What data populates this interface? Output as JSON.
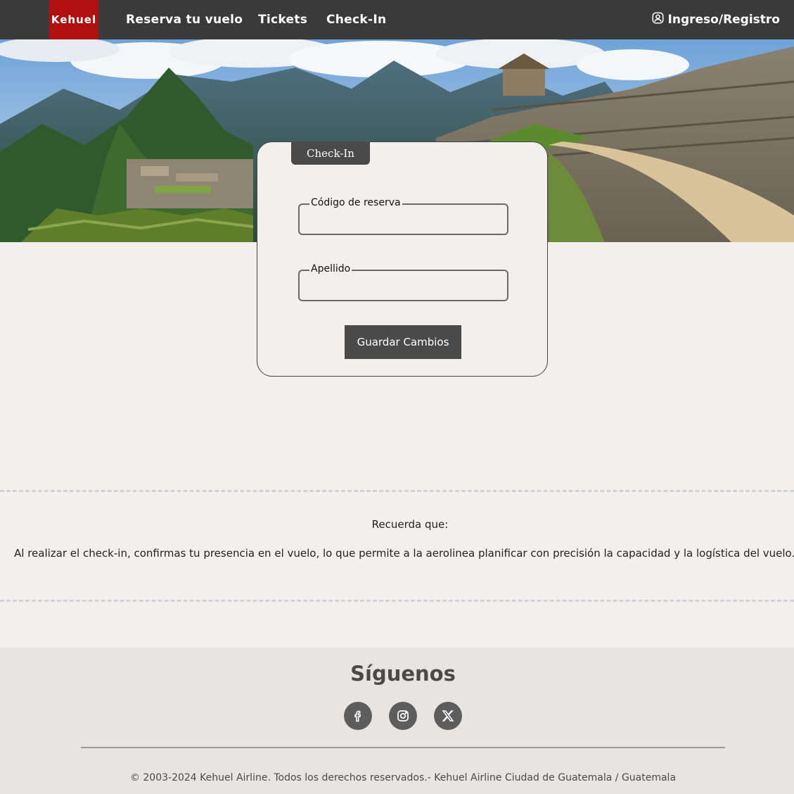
{
  "navbar": {
    "logo": "Kehuel",
    "links": [
      "Reserva tu vuelo",
      "Tickets",
      "Check-In"
    ],
    "login_label": "Ingreso/Registro",
    "login_icon": "user-circle-icon"
  },
  "checkin_card": {
    "tab_label": "Check-In",
    "reservation_code_label": "Código de reserva",
    "reservation_code_value": "",
    "last_name_label": "Apellido",
    "last_name_value": "",
    "save_button": "Guardar Cambios"
  },
  "info": {
    "title": "Recuerda que:",
    "text": "Al realizar el check-in, confirmas tu presencia en el vuelo, lo que permite a la aerolinea planificar con precisión la capacidad y la logística del vuelo."
  },
  "footer": {
    "follow_title": "Síguenos",
    "social_icons": [
      "facebook-icon",
      "instagram-icon",
      "x-twitter-icon"
    ],
    "copyright": "© 2003-2024 Kehuel Airline. Todos los derechos reservados.- Kehuel Airline Ciudad de Guatemala / Guatemala"
  },
  "colors": {
    "navbar": "#3a3a3a",
    "logo_bg": "#b0100f",
    "page_bg": "#f1f0ed",
    "button_bg": "#4a4a4a",
    "footer_bg": "#e6e5e3"
  }
}
